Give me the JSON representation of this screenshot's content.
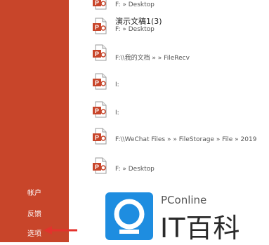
{
  "sidebar": {
    "items": [
      {
        "label": "帐户"
      },
      {
        "label": "反馈"
      },
      {
        "label": "选项"
      }
    ]
  },
  "files": [
    {
      "name": "",
      "path": "F: » Desktop"
    },
    {
      "name": "演示文稿1(3)",
      "path": "F: » Desktop"
    },
    {
      "name": "",
      "path": "F:\\\\我的文档 »                  » FileRecv"
    },
    {
      "name": "",
      "path": "I:"
    },
    {
      "name": "",
      "path": "I:"
    },
    {
      "name": "",
      "path": "F:\\\\WeChat Files »           » FileStorage » File » 2019"
    },
    {
      "name": "",
      "path": "F: » Desktop"
    }
  ],
  "watermark": {
    "brand": "PConline",
    "title": "IT百科"
  },
  "colors": {
    "sidebar_bg": "#c8452a",
    "icon_red": "#c8452a",
    "arrow_red": "#e3322c"
  }
}
